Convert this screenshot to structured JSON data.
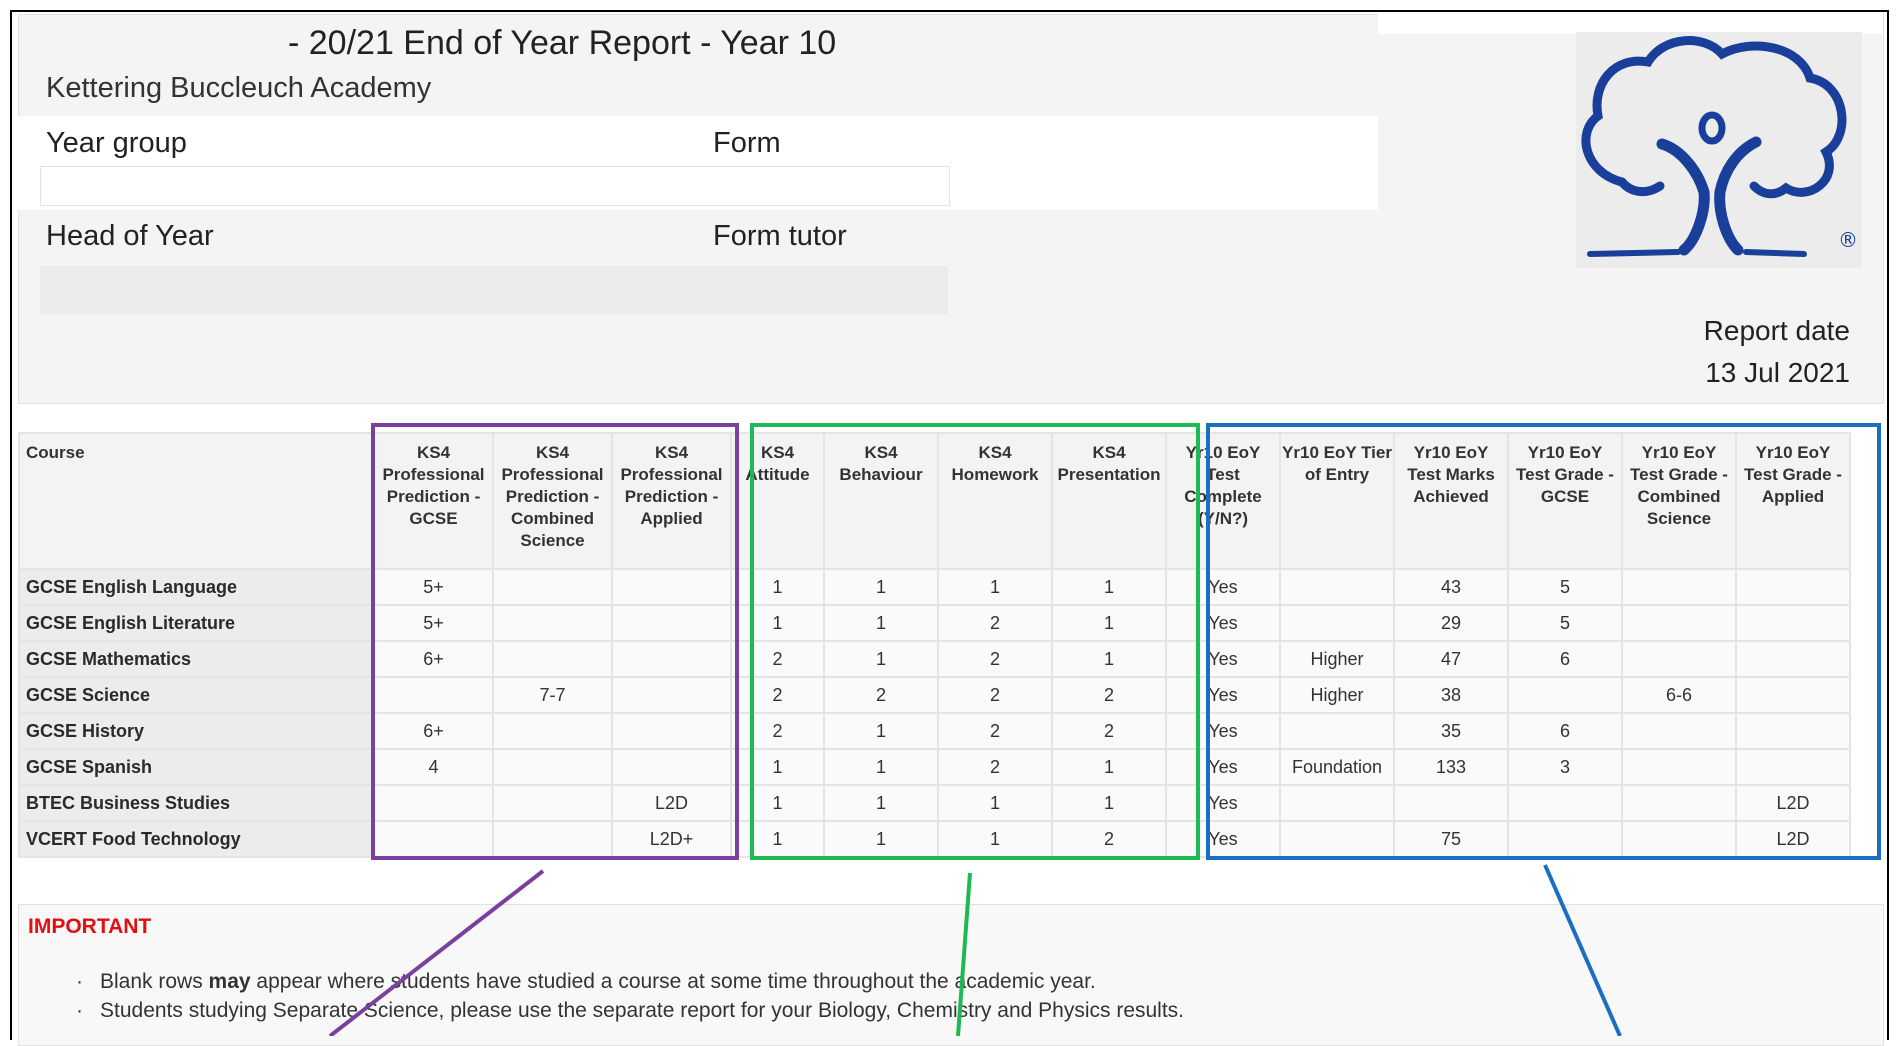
{
  "header": {
    "title": "- 20/21 End of Year Report - Year 10",
    "school": "Kettering Buccleuch Academy",
    "labels": {
      "year_group": "Year group",
      "form": "Form",
      "head_of_year": "Head of Year",
      "form_tutor": "Form tutor"
    },
    "report_date_label": "Report date",
    "report_date": "13 Jul 2021"
  },
  "table": {
    "columns": [
      "Course",
      "KS4 Professional Prediction - GCSE",
      "KS4 Professional Prediction - Combined Science",
      "KS4 Professional Prediction - Applied",
      "KS4 Attitude",
      "KS4 Behaviour",
      "KS4 Homework",
      "KS4 Presentation",
      "Yr10 EoY Test Complete (Y/N?)",
      "Yr10 EoY Tier of Entry",
      "Yr10 EoY Test Marks Achieved",
      "Yr10 EoY Test Grade - GCSE",
      "Yr10 EoY Test Grade - Combined Science",
      "Yr10 EoY Test Grade - Applied"
    ],
    "rows": [
      [
        "GCSE English Language",
        "5+",
        "",
        "",
        "1",
        "1",
        "1",
        "1",
        "Yes",
        "",
        "43",
        "5",
        "",
        ""
      ],
      [
        "GCSE English Literature",
        "5+",
        "",
        "",
        "1",
        "1",
        "2",
        "1",
        "Yes",
        "",
        "29",
        "5",
        "",
        ""
      ],
      [
        "GCSE Mathematics",
        "6+",
        "",
        "",
        "2",
        "1",
        "2",
        "1",
        "Yes",
        "Higher",
        "47",
        "6",
        "",
        ""
      ],
      [
        "GCSE Science",
        "",
        "7-7",
        "",
        "2",
        "2",
        "2",
        "2",
        "Yes",
        "Higher",
        "38",
        "",
        "6-6",
        ""
      ],
      [
        "GCSE History",
        "6+",
        "",
        "",
        "2",
        "1",
        "2",
        "2",
        "Yes",
        "",
        "35",
        "6",
        "",
        ""
      ],
      [
        "GCSE Spanish",
        "4",
        "",
        "",
        "1",
        "1",
        "2",
        "1",
        "Yes",
        "Foundation",
        "133",
        "3",
        "",
        ""
      ],
      [
        "BTEC Business Studies",
        "",
        "",
        "L2D",
        "1",
        "1",
        "1",
        "1",
        "Yes",
        "",
        "",
        "",
        "",
        "L2D"
      ],
      [
        "VCERT Food Technology",
        "",
        "",
        "L2D+",
        "1",
        "1",
        "1",
        "2",
        "Yes",
        "",
        "75",
        "",
        "",
        "L2D"
      ]
    ]
  },
  "notes": {
    "heading": "IMPORTANT",
    "items": [
      {
        "before": "Blank rows ",
        "bold": "may",
        "after": " appear where students have studied a course at some time throughout the academic year."
      },
      {
        "before": "Students studying Separate Science, please use the separate report for your Biology, Chemistry and Physics results.",
        "bold": "",
        "after": ""
      }
    ]
  },
  "colors": {
    "highlight_purple": "#7b3fa0",
    "highlight_green": "#1db954",
    "highlight_blue": "#1a6fc2",
    "important_red": "#e01010",
    "logo_blue": "#1a3f9a"
  }
}
